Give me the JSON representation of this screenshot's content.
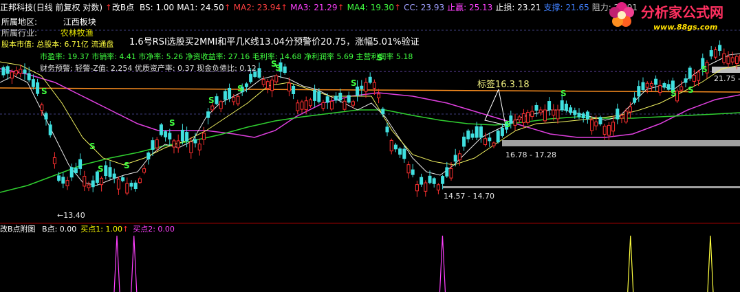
{
  "title_bar": {
    "stock_name": "正邦科技",
    "mode": "(日线 前复权 对数)",
    "indicator_name": "改B点",
    "items": [
      {
        "label": "BS: 1.00",
        "color": "#ffffff"
      },
      {
        "label": "MA1: 24.50",
        "color": "#ffffff",
        "arrow": "↑"
      },
      {
        "label": "MA2: 23.94",
        "color": "#ff4040",
        "arrow": "↑"
      },
      {
        "label": "MA3: 21.29",
        "color": "#ff40ff",
        "arrow": "↑"
      },
      {
        "label": "MA4: 19.30",
        "color": "#40ff40",
        "arrow": "↑"
      },
      {
        "label": "CC: 23.93",
        "color": "#a0a0ff"
      },
      {
        "label": "止赢: 25.13",
        "color": "#ff40ff"
      },
      {
        "label": "止损: 23.21",
        "color": "#ffffff"
      },
      {
        "label": "支撑: 21.65",
        "color": "#4080ff"
      },
      {
        "label": "阻力: 24.91",
        "color": "#c0c0c0"
      }
    ]
  },
  "info": {
    "region_label": "所属地区:",
    "region_value": "江西板块",
    "industry_label": "所属行业:",
    "industry_value": "农林牧渔",
    "signal_text": "1.6号RSI选股买2MMI和平几K线13.04分预警价20.75，涨幅5.01%验证",
    "market_value_line": "股本市值: 总股本: 6.71亿 流通盘",
    "fundamentals_line": "市盈率: 19.37 市销率: 4.41 市净率: 5.26 净资收益率: 27.16 毛利率: 14.68 净利润率 5.69 主营利润率 5.18",
    "finance_prefix": "财务预警: 轻警-Z值: 2.254 优质资产率: 0.37 现金负债比: 0.12"
  },
  "annotations": {
    "tag_label": "标签16.3.18",
    "range_1": "16.78 - 17.28",
    "range_2": "14.57 - 14.70",
    "low_label": "←13.40",
    "right_label": "21.75 -",
    "s_marker": "S"
  },
  "sub_panel": {
    "title": "改B点附图",
    "items": [
      {
        "label": "B点: 0.00",
        "color": "#ffffff"
      },
      {
        "label": "买点1: 1.00",
        "color": "#ffff00",
        "arrow": "↑"
      },
      {
        "label": "买点2: 0.00",
        "color": "#ff40ff"
      }
    ],
    "spikes": [
      {
        "pos": 0.158,
        "height": 1.0,
        "color": "#ff40ff"
      },
      {
        "pos": 0.181,
        "height": 1.0,
        "color": "#ff40ff"
      },
      {
        "pos": 0.598,
        "height": 1.0,
        "color": "#ff40ff"
      },
      {
        "pos": 0.852,
        "height": 1.0,
        "color": "#ffff40"
      },
      {
        "pos": 0.96,
        "height": 1.0,
        "color": "#ffff40"
      }
    ]
  },
  "logo": {
    "text": "分析家公式网",
    "url": "www.88gs.com"
  },
  "colors": {
    "up": "#ff3030",
    "down": "#40e0e0",
    "orange_line": "#ff9020",
    "magenta_line": "#e040e0",
    "green_line": "#30d030",
    "white_line": "#ffffff",
    "yellow_line": "#f0f060",
    "panel_border": "#a00000"
  }
}
